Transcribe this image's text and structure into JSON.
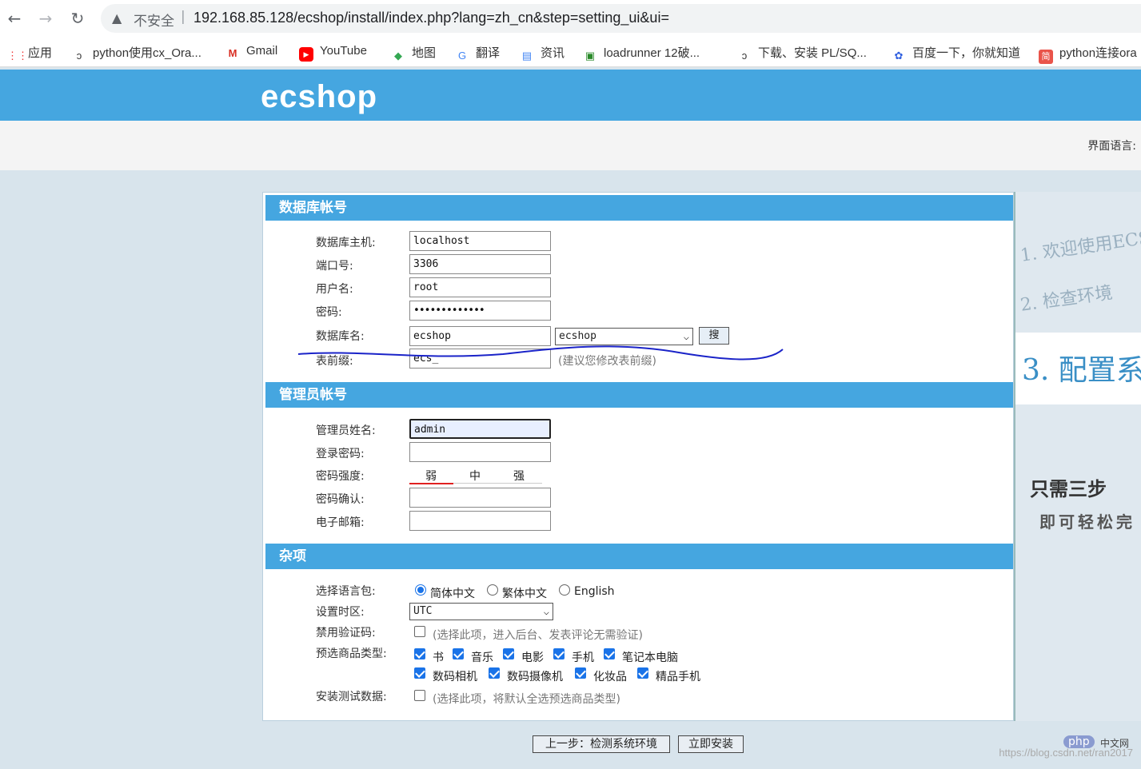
{
  "browser": {
    "insecure_label": "不安全",
    "separator": "|",
    "url": "192.168.85.128/ecshop/install/index.php?lang=zh_cn&step=setting_ui&ui="
  },
  "bookmarks": [
    {
      "label": "应用",
      "icon": "apps-grid-icon"
    },
    {
      "label": "python使用cx_Ora...",
      "icon": "oracle-icon"
    },
    {
      "label": "Gmail",
      "icon": "gmail-icon"
    },
    {
      "label": "YouTube",
      "icon": "youtube-icon"
    },
    {
      "label": "地图",
      "icon": "maps-icon"
    },
    {
      "label": "翻译",
      "icon": "translate-icon"
    },
    {
      "label": "资讯",
      "icon": "news-icon"
    },
    {
      "label": "loadrunner 12破...",
      "icon": "loadrunner-icon"
    },
    {
      "label": "下载、安装 PL/SQ...",
      "icon": "oracle-icon"
    },
    {
      "label": "百度一下，你就知道",
      "icon": "baidu-icon"
    },
    {
      "label": "python连接ora",
      "icon": "jianshu-icon"
    }
  ],
  "site": {
    "logo": "ecshop",
    "lang_label": "界面语言:"
  },
  "db": {
    "header": "数据库帐号",
    "host_label": "数据库主机:",
    "host": "localhost",
    "port_label": "端口号:",
    "port": "3306",
    "user_label": "用户名:",
    "user": "root",
    "pass_label": "密码:",
    "pass_mask": "•••••••••••••",
    "name_label": "数据库名:",
    "name": "ecshop",
    "name_select": "ecshop",
    "search_btn": "搜",
    "prefix_label": "表前缀:",
    "prefix": "ecs_",
    "prefix_hint": "(建议您修改表前缀)"
  },
  "admin": {
    "header": "管理员帐号",
    "name_label": "管理员姓名:",
    "name": "admin",
    "pass_label": "登录密码:",
    "strength_label": "密码强度:",
    "weak": "弱",
    "medium": "中",
    "strong": "强",
    "confirm_label": "密码确认:",
    "email_label": "电子邮箱:"
  },
  "misc": {
    "header": "杂项",
    "lang_label": "选择语言包:",
    "lang_opts": [
      "简体中文",
      "繁体中文",
      "English"
    ],
    "tz_label": "设置时区:",
    "tz": "UTC",
    "captcha_label": "禁用验证码:",
    "captcha_hint": "(选择此项，进入后台、发表评论无需验证)",
    "types_label": "预选商品类型:",
    "types": [
      "书",
      "音乐",
      "电影",
      "手机",
      "笔记本电脑",
      "数码相机",
      "数码摄像机",
      "化妆品",
      "精品手机"
    ],
    "testdata_label": "安装测试数据:",
    "testdata_hint": "(选择此项，将默认全选预选商品类型)"
  },
  "steps": {
    "s1": "1. 欢迎使用ECS",
    "s2": "2. 检查环境",
    "s3": "3. 配置系",
    "slogan1": "只需三步",
    "slogan2": "即可轻松完"
  },
  "buttons": {
    "prev": "上一步：检测系统环境",
    "install": "立即安装"
  },
  "watermark": "https://blog.csdn.net/ran2017",
  "php_logo": "php",
  "php_site": "中文网"
}
